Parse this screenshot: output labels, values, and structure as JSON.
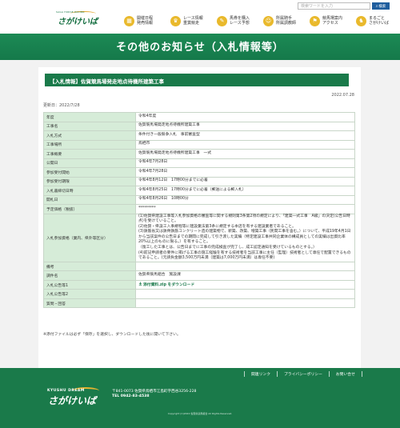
{
  "header": {
    "logo_sub": "SAGA HORSE RACING",
    "logo_text": "さがけいば",
    "search": {
      "placeholder": "検索ワードを入力",
      "button_label": "検索"
    },
    "nav": [
      {
        "label": "開催日程\n発売情報",
        "icon": "calendar-icon",
        "glyph": "▦"
      },
      {
        "label": "レース情報\n重賞競走",
        "icon": "trophy-icon",
        "glyph": "♛"
      },
      {
        "label": "馬券を購入\nレース予想",
        "icon": "ticket-icon",
        "glyph": "✎"
      },
      {
        "label": "所属騎手\n所属調教師",
        "icon": "jockey-icon",
        "glyph": "☺"
      },
      {
        "label": "競馬場案内\nアクセス",
        "icon": "map-pin-icon",
        "glyph": "⚑"
      },
      {
        "label": "まるごと\nさがけいば",
        "icon": "horse-icon",
        "glyph": "♞"
      }
    ]
  },
  "banner": {
    "title": "その他のお知らせ（入札情報等）"
  },
  "news": {
    "title": "【入札情報】佐賀競馬場発走地点待機所建築工事",
    "date": "2022.07.28",
    "updated": "更新日：2022/7/28",
    "rows": [
      {
        "key": "年度",
        "value": "令和4年度"
      },
      {
        "key": "工事名",
        "value": "佐賀競馬場発走地点待機所建築工事"
      },
      {
        "key": "入札方式",
        "value": "条件付き一般競争入札　事前審査型"
      },
      {
        "key": "工事場所",
        "value": "鳥栖市"
      },
      {
        "key": "工事概要",
        "value": "佐賀競馬場発走地点待機所建築工事　一式"
      },
      {
        "key": "公開日",
        "value": "令和4年7月28日"
      },
      {
        "key": "参加受付開始",
        "value": "令和4年7月28日"
      },
      {
        "key": "参加受付期限",
        "value": "令和4年8月12日　17時00分までに必着"
      },
      {
        "key": "入札書締切日時",
        "value": "令和4年8月25日　17時00分までに必着（郵送による郵入札）"
      },
      {
        "key": "開札日",
        "value": "令和4年8月26日　10時00分"
      },
      {
        "key": "予定価格（税抜）",
        "value": "*********"
      },
      {
        "key": "入札参加資格（業内、県外等区分）",
        "value": "(1)佐賀県建設工事等入札参加資格の審査等に関する規則第3条第2項の規定により、「建築一式工事　A級」の決定(公告日時点)を受けていること。\n(2)佐賀・県設工入事規程等に建設業法第3条に規定する本店を有する建設業者であること。\n(3)鉄筋省又は鉄骨鉄筋コンクリート造の建築物で、新築、改築、増築工事（民間工事を含む。）について、平成19年4月1日から当該案件の公告日までの期間に完成して引き渡した実績（特定建設工事共同企業体の構成員としての実績は出資比率　20%以上のものに限る。）を有すること。\n（復工した工事とは、公告日までに工事の完成検査が完了し、成工認定通知を受けているものとする。）\n(4)前記申請者の要件に掲げる工事の施工経験を有する技術者を当該工事に主任（監理）技術者として専任で配置できるものであること。(元請負金額3,500万円未満（建築は7,000万円未満）は専任不要)"
      },
      {
        "key": "備考",
        "value": ""
      },
      {
        "key": "調件名",
        "value": "佐賀県競馬組合　施設課"
      },
      {
        "key": "入札公告等1",
        "value": "添付資料.zip をダウンロード",
        "link": true
      },
      {
        "key": "入札公告等2",
        "value": ""
      },
      {
        "key": "質問・回答",
        "value": ""
      }
    ],
    "note": "※添付ファイルは必ず「保存」を選択し、ダウンロードした後に開いて下さい。"
  },
  "footer": {
    "links": [
      "関連リンク",
      "プライバシーポリシー",
      "お問い合せ"
    ],
    "logo_sub": "KYUSHU DREAM",
    "logo_text": "さがけいば",
    "address": "〒841-0073 佐賀県鳥栖市江島町字西谷3256-228",
    "tel": "TEL 0942-83-4538",
    "copyright": "Copyright (C)2022 佐賀県競馬組合 All Rights Reserved."
  },
  "colors": {
    "brand_green": "#1a7a4a",
    "accent_yellow": "#e9b92c",
    "table_key_bg": "#d6ecd8"
  }
}
